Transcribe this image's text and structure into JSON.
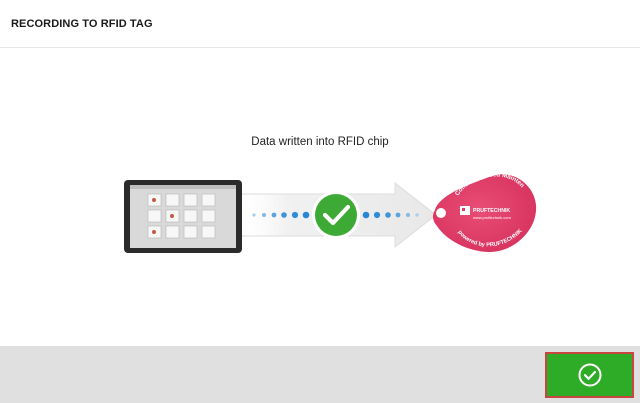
{
  "header": {
    "title": "RECORDING TO RFID TAG"
  },
  "main": {
    "status_message": "Data written into RFID chip",
    "illustration": {
      "device": "tablet-icon",
      "arrow": "arrow-icon",
      "status_icon": "checkmark-icon",
      "target": "rfid-tag-icon",
      "tag_text_top": "Condition based Maintenance",
      "tag_text_bottom": "powered by PRUFTECHNIK",
      "tag_brand": "PRUFTECHNIK",
      "tag_url": "www.pruftechnik.com"
    }
  },
  "footer": {
    "confirm_icon": "check-circle-icon"
  },
  "colors": {
    "success_green": "#3daa35",
    "button_green": "#2eab27",
    "button_border": "#c8463f",
    "tag_pink": "#de3a64",
    "dot_blue": "#2f8dd8",
    "footer_bg": "#e0e0e0"
  }
}
